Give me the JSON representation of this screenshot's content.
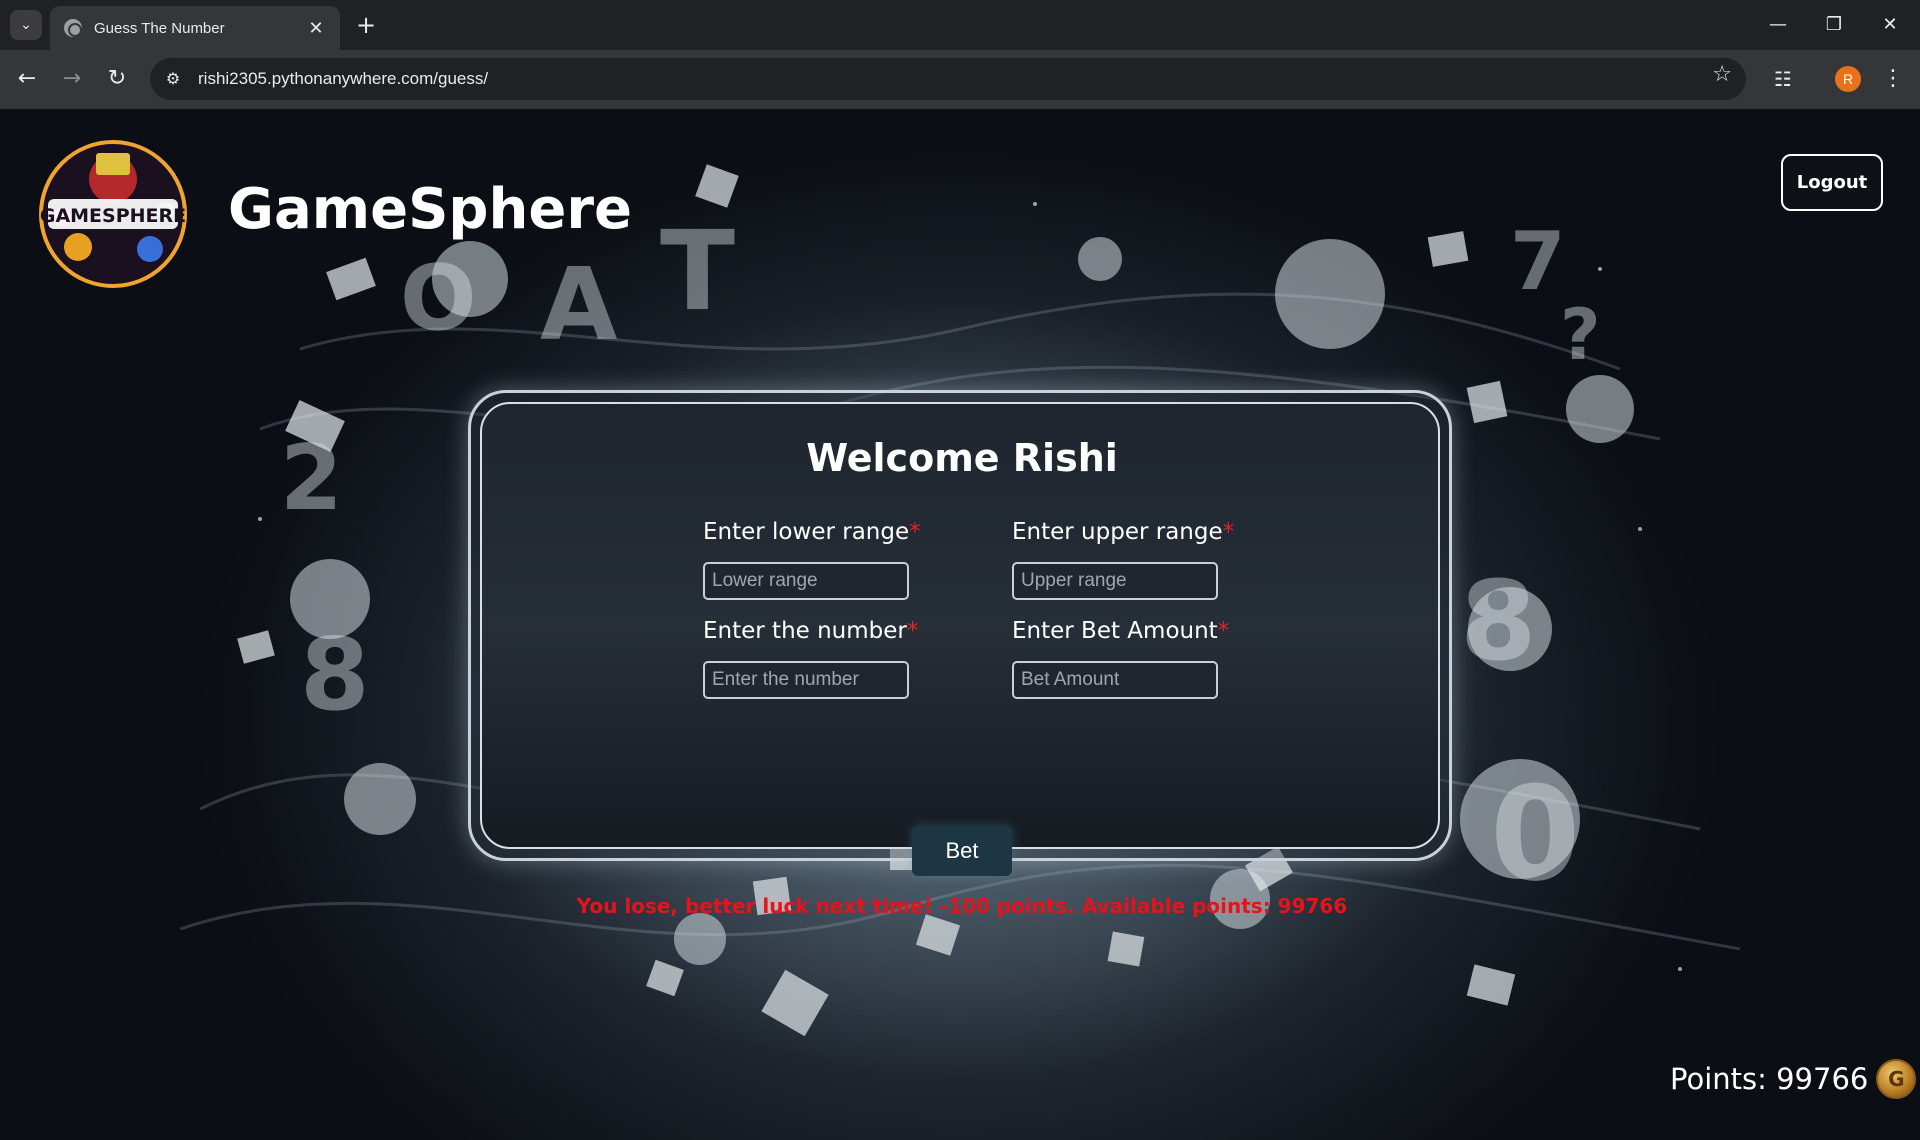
{
  "browser": {
    "tab_title": "Guess The Number",
    "url": "rishi2305.pythonanywhere.com/guess/",
    "profile_initial": "R"
  },
  "header": {
    "logo_text": "GAMESPHERE",
    "site_title": "GameSphere",
    "logout_label": "Logout"
  },
  "form": {
    "welcome": "Welcome Rishi",
    "lower_label": "Enter lower range",
    "lower_placeholder": "Lower range",
    "upper_label": "Enter upper range",
    "upper_placeholder": "Upper range",
    "number_label": "Enter the number",
    "number_placeholder": "Enter the number",
    "bet_label": "Enter Bet Amount",
    "bet_placeholder": "Bet Amount",
    "required_mark": "*",
    "submit_label": "Bet",
    "result_message": "You lose, better luck next time! -100 points. Available points: 99766"
  },
  "footer": {
    "points_text": "Points: 99766",
    "coin_letter": "G"
  },
  "colors": {
    "error": "#e4141a",
    "required": "#e02424",
    "profile": "#e8711b"
  }
}
